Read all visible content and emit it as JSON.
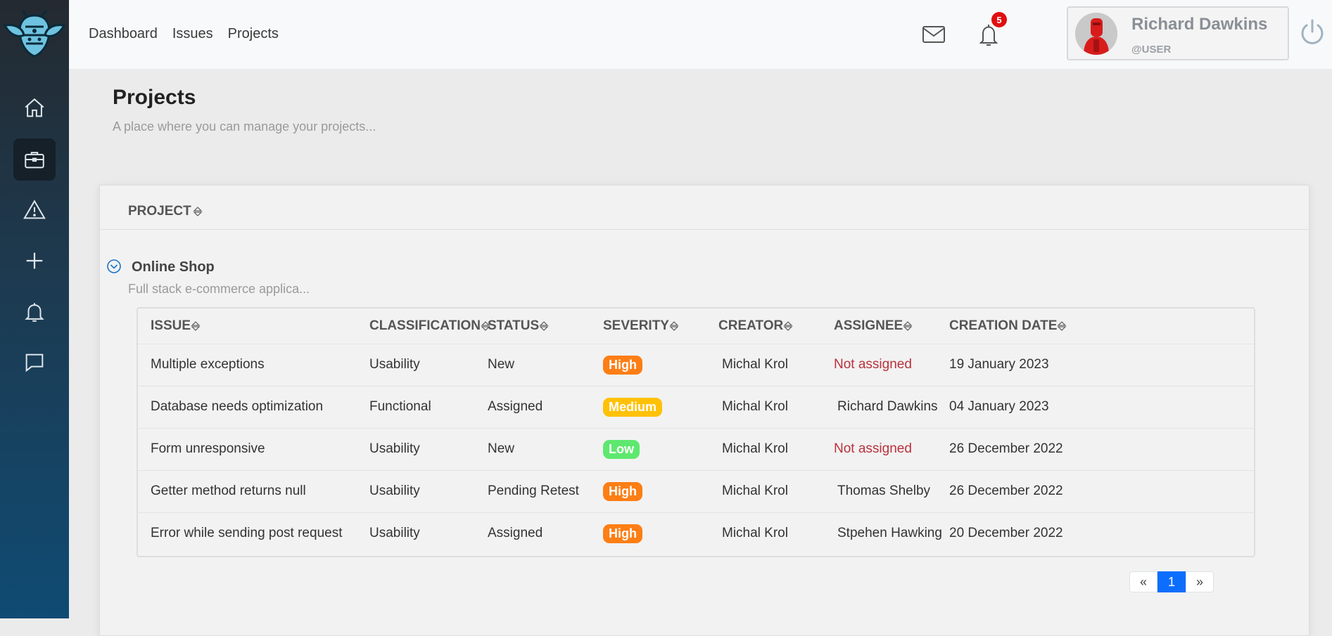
{
  "nav": {
    "dashboard": "Dashboard",
    "issues": "Issues",
    "projects": "Projects"
  },
  "notifications": {
    "count": "5"
  },
  "user": {
    "name": "Richard Dawkins",
    "role": "@USER"
  },
  "page": {
    "title": "Projects",
    "subtitle": "A place where you can manage your projects..."
  },
  "table": {
    "project_header": "PROJECT"
  },
  "project": {
    "name": "Online Shop",
    "description": "Full stack e-commerce applica..."
  },
  "issues": {
    "headers": [
      "ISSUE",
      "CLASSIFICATION",
      "STATUS",
      "SEVERITY",
      "CREATOR",
      "ASSIGNEE",
      "CREATION DATE"
    ],
    "rows": [
      [
        "Multiple exceptions",
        "Usability",
        "New",
        "High",
        "Michal Krol",
        "Not assigned",
        "19 January 2023"
      ],
      [
        "Database needs optimization",
        "Functional",
        "Assigned",
        "Medium",
        "Michal Krol",
        "Richard Dawkins",
        "04 January 2023"
      ],
      [
        "Form unresponsive",
        "Usability",
        "New",
        "Low",
        "Michal Krol",
        "Not assigned",
        "26 December 2022"
      ],
      [
        "Getter method returns null",
        "Usability",
        "Pending Retest",
        "High",
        "Michal Krol",
        "Thomas Shelby",
        "26 December 2022"
      ],
      [
        "Error while sending post request",
        "Usability",
        "Assigned",
        "High",
        "Michal Krol",
        "Stpehen Hawking",
        "20 December 2022"
      ]
    ]
  },
  "severity_colors": {
    "High": "#fd7e14",
    "Medium": "#ffc107",
    "Low": "#5ee86f"
  },
  "pagination": {
    "prev": "«",
    "current": "1",
    "next": "»"
  },
  "icons": {
    "logo": "bug-logo-icon",
    "sidebar": [
      "home-icon",
      "briefcase-icon",
      "warning-icon",
      "plus-icon",
      "bell-icon",
      "chat-icon"
    ],
    "header": [
      "mail-icon",
      "bell-icon",
      "power-icon"
    ]
  },
  "colors": {
    "accent": "#0d6efd",
    "not_assigned": "#b8323d"
  }
}
